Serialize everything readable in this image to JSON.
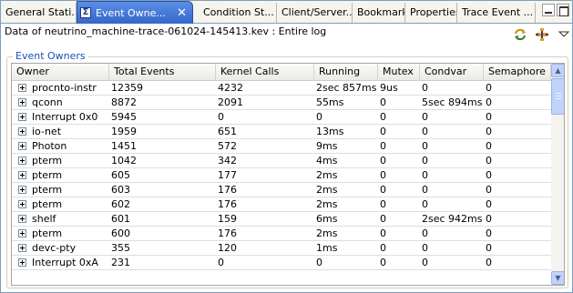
{
  "tabs": [
    {
      "label": "General Stati..."
    },
    {
      "label": "Event Owne...",
      "active": true
    },
    {
      "label": "Condition St..."
    },
    {
      "label": "Client/Server..."
    },
    {
      "label": "Bookmarks"
    },
    {
      "label": "Properties"
    },
    {
      "label": "Trace Event ..."
    }
  ],
  "header": {
    "title": "Data of neutrino_machine-trace-061024-145413.kev : Entire log"
  },
  "group": {
    "label": "Event Owners"
  },
  "table": {
    "columns": [
      "Owner",
      "Total Events",
      "Kernel Calls",
      "Running",
      "Mutex",
      "Condvar",
      "Semaphore"
    ],
    "rows": [
      [
        "procnto-instr",
        "12359",
        "4232",
        "2sec 857ms",
        "9us",
        "0",
        "0"
      ],
      [
        "qconn",
        "8872",
        "2091",
        "55ms",
        "0",
        "5sec 894ms",
        "0"
      ],
      [
        "Interrupt 0x0",
        "5945",
        "0",
        "0",
        "0",
        "0",
        "0"
      ],
      [
        "io-net",
        "1959",
        "651",
        "13ms",
        "0",
        "0",
        "0"
      ],
      [
        "Photon",
        "1451",
        "572",
        "9ms",
        "0",
        "0",
        "0"
      ],
      [
        "pterm",
        "1042",
        "342",
        "4ms",
        "0",
        "0",
        "0"
      ],
      [
        "pterm",
        "605",
        "177",
        "2ms",
        "0",
        "0",
        "0"
      ],
      [
        "pterm",
        "603",
        "176",
        "2ms",
        "0",
        "0",
        "0"
      ],
      [
        "pterm",
        "602",
        "176",
        "2ms",
        "0",
        "0",
        "0"
      ],
      [
        "shelf",
        "601",
        "159",
        "6ms",
        "0",
        "2sec 942ms",
        "0"
      ],
      [
        "pterm",
        "600",
        "176",
        "2ms",
        "0",
        "0",
        "0"
      ],
      [
        "devc-pty",
        "355",
        "120",
        "1ms",
        "0",
        "0",
        "0"
      ],
      [
        "Interrupt 0xA",
        "231",
        "0",
        "0",
        "0",
        "0",
        "0"
      ]
    ]
  },
  "icons": {
    "tab_icon": "sigma-icon",
    "sync": "sync-icon",
    "fan": "fan-icon",
    "menu": "view-menu-icon"
  }
}
